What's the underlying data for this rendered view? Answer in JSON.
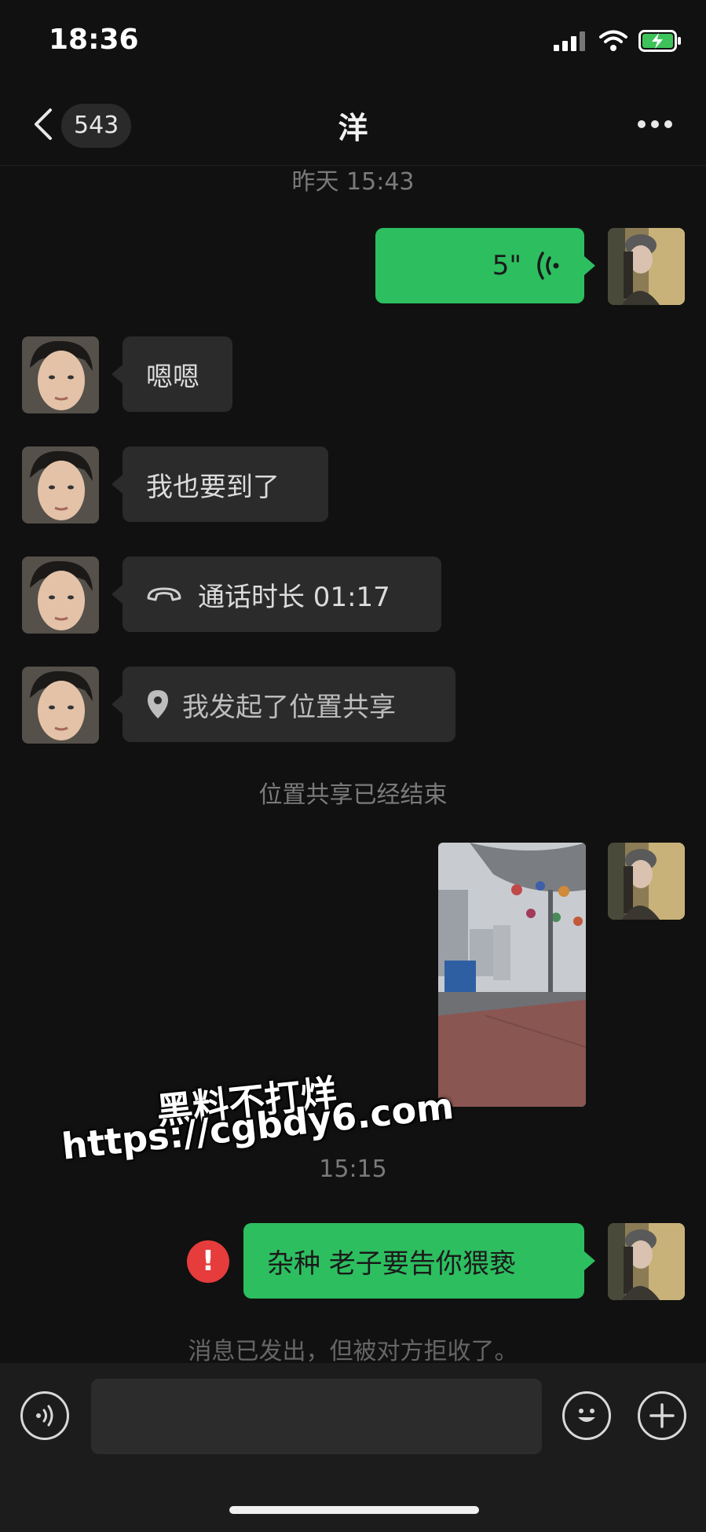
{
  "status_bar": {
    "time": "18:36"
  },
  "nav": {
    "unread_count": "543",
    "title": "洋"
  },
  "messages": {
    "timestamp_1": "昨天 15:43",
    "voice_duration": "5\"",
    "msg_1": "嗯嗯",
    "msg_2": "我也要到了",
    "call_label": "通话时长 01:17",
    "location_label": "我发起了位置共享",
    "system_1": "位置共享已经结束",
    "timestamp_2": "15:15",
    "rejected_msg": "杂种 老子要告你猥亵",
    "system_2": "消息已发出，但被对方拒收了。"
  },
  "watermark": {
    "line1": "黑料不打烊",
    "line2": "https://cgbdy6.com"
  },
  "colors": {
    "outgoing_bubble": "#2dbe60",
    "incoming_bubble": "#2b2b2b",
    "error": "#e63c3c"
  }
}
